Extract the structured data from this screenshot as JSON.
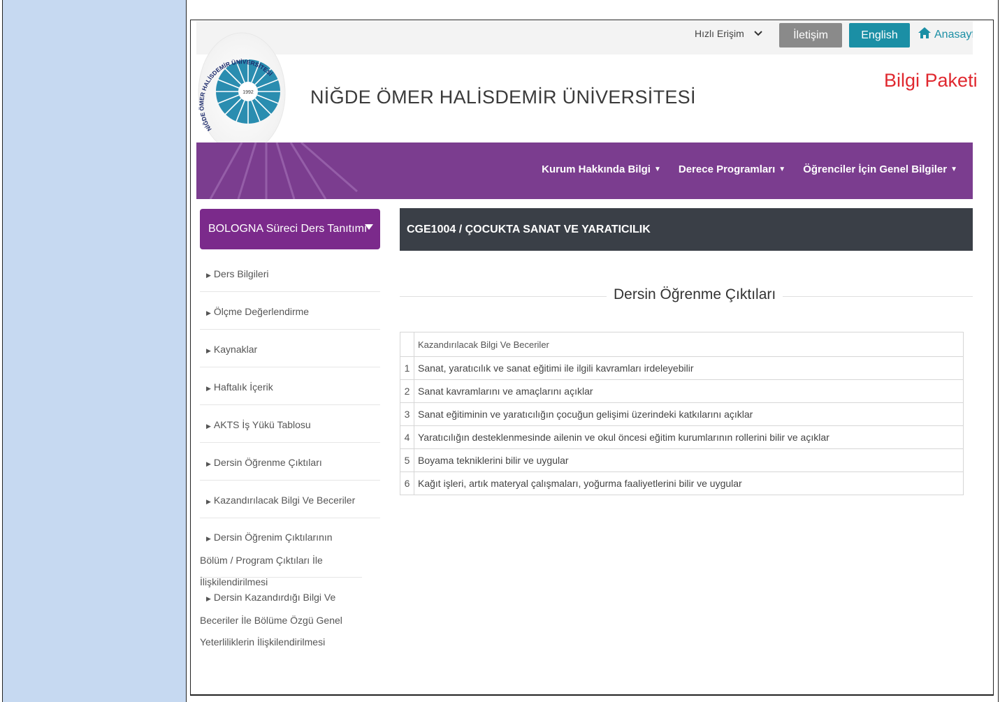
{
  "topbar": {
    "quick_access": "Hızlı Erişim",
    "contact": "İletişim",
    "english": "English",
    "home": "Anasayfa"
  },
  "header": {
    "university_name": "NİĞDE ÖMER HALİSDEMİR ÜNİVERSİTESİ",
    "logo_text": "NİĞDE ÖMER HALİSDEMİR ÜNİVERSİTESİ",
    "logo_year": "1992",
    "info_package": "Bilgi Paketi"
  },
  "nav": {
    "items": [
      {
        "label": "Kurum Hakkında Bilgi"
      },
      {
        "label": "Derece Programları"
      },
      {
        "label": "Öğrenciler İçin Genel Bilgiler"
      }
    ]
  },
  "sidebar": {
    "title": "BOLOGNA Süreci Ders Tanıtımı",
    "items": [
      {
        "label": "Ders Bilgileri"
      },
      {
        "label": "Ölçme Değerlendirme"
      },
      {
        "label": "Kaynaklar"
      },
      {
        "label": "Haftalık İçerik"
      },
      {
        "label": "AKTS İş Yükü Tablosu"
      },
      {
        "label": "Dersin Öğrenme Çıktıları"
      },
      {
        "label": "Kazandırılacak Bilgi Ve Beceriler"
      },
      {
        "label": "Dersin Öğrenim Çıktılarının Bölüm / Program Çıktıları İle İlişkilendirilmesi"
      },
      {
        "label": "Dersin Kazandırdığı Bilgi Ve Beceriler İle Bölüme Özgü Genel Yeterliliklerin İlişkilendirilmesi"
      }
    ]
  },
  "main": {
    "course_title": "CGE1004 / ÇOCUKTA SANAT VE YARATICILIK",
    "section_title": "Dersin Öğrenme Çıktıları",
    "table_header": "Kazandırılacak Bilgi Ve Beceriler",
    "rows": [
      {
        "num": "1",
        "text": "Sanat, yaratıcılık ve sanat eğitimi ile ilgili kavramları irdeleyebilir"
      },
      {
        "num": "2",
        "text": "Sanat kavramlarını ve amaçlarını açıklar"
      },
      {
        "num": "3",
        "text": "Sanat eğitiminin ve yaratıcılığın çocuğun gelişimi üzerindeki katkılarını açıklar"
      },
      {
        "num": "4",
        "text": "Yaratıcılığın desteklenmesinde ailenin ve okul öncesi eğitim kurumlarının rollerini bilir ve açıklar"
      },
      {
        "num": "5",
        "text": "Boyama tekniklerini bilir ve uygular"
      },
      {
        "num": "6",
        "text": "Kağıt işleri, artık materyal çalışmaları, yoğurma faaliyetlerini bilir ve uygular"
      }
    ]
  },
  "colors": {
    "nav_purple": "#7b3d8f",
    "sidebar_purple": "#7b2a8b",
    "english_teal": "#1b8fa5",
    "contact_gray": "#8a8a8a",
    "title_red": "#e0282f",
    "course_bar": "#3a3f47",
    "left_panel": "#c6d9f1"
  }
}
